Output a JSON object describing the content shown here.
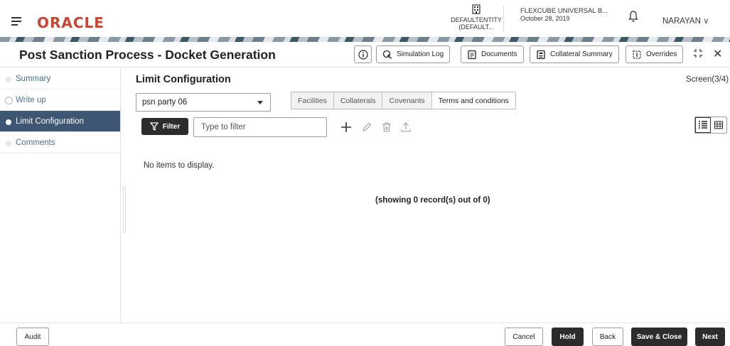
{
  "header": {
    "brand": "ORACLE",
    "entity": "DEFAULTENTITY (DEFAULT...",
    "branch_name": "FLEXCUBE UNIVERSAL B...",
    "branch_date": "October 28, 2019",
    "user": "NARAYAN"
  },
  "titlebar": {
    "title": "Post Sanction Process - Docket Generation",
    "simulation_log": "Simulation Log",
    "documents": "Documents",
    "collateral_summary": "Collateral Summary",
    "overrides": "Overrides"
  },
  "sidebar": {
    "items": [
      {
        "label": "Summary"
      },
      {
        "label": "Write up"
      },
      {
        "label": "Limit Configuration"
      },
      {
        "label": "Comments"
      }
    ]
  },
  "main": {
    "title": "Limit Configuration",
    "screen_indicator": "Screen(3/4)",
    "party_select": "psn party 06",
    "tabs": [
      {
        "label": "Facilities"
      },
      {
        "label": "Collaterals"
      },
      {
        "label": "Covenants"
      },
      {
        "label": "Terms and conditions"
      }
    ],
    "filter_label": "Filter",
    "filter_placeholder": "Type to filter",
    "empty_message": "No items to display.",
    "records_text": "(showing 0 record(s) out of 0)"
  },
  "footer": {
    "audit": "Audit",
    "cancel": "Cancel",
    "hold": "Hold",
    "back": "Back",
    "save_close": "Save & Close",
    "next": "Next"
  }
}
